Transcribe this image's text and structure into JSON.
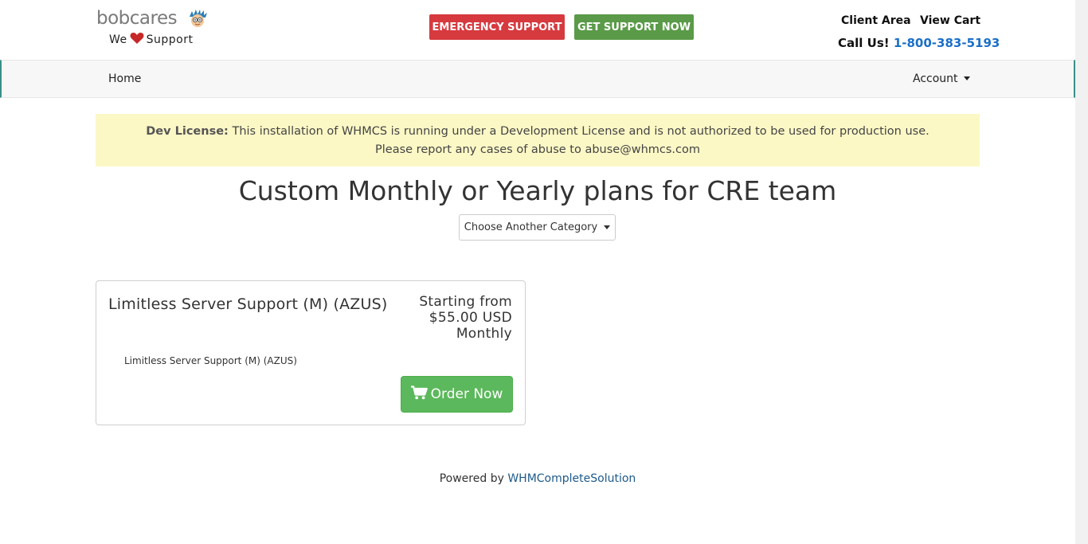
{
  "header": {
    "logo_word": "bobcares",
    "logo_tag_before": "We",
    "logo_tag_after": "Support",
    "emergency_label": "EMERGENCY SUPPORT",
    "get_support_label": "GET SUPPORT NOW",
    "client_area_label": "Client Area",
    "view_cart_label": "View Cart",
    "call_label": "Call Us!",
    "phone": "1-800-383-5193"
  },
  "nav": {
    "home_label": "Home",
    "account_label": "Account"
  },
  "notice": {
    "label": "Dev License:",
    "text": "This installation of WHMCS is running under a Development License and is not authorized to be used for production use. Please report any cases of abuse to abuse@whmcs.com"
  },
  "main": {
    "title": "Custom Monthly or Yearly plans for CRE team",
    "category_select_label": "Choose Another Category"
  },
  "product": {
    "name": "Limitless Server Support (M) (AZUS)",
    "price_line1": "Starting from",
    "price_line2": "$55.00 USD",
    "price_line3": "Monthly",
    "description": "Limitless Server Support (M) (AZUS)",
    "order_label": "Order Now"
  },
  "footer": {
    "powered_by": "Powered by",
    "link_label": "WHMCompleteSolution"
  },
  "colors": {
    "emergency": "#d63a3f",
    "get_support": "#5a9a48",
    "phone": "#1b6fc7",
    "notice_bg": "#fcf8c6",
    "order_button": "#5cb85c",
    "footer_link": "#1d5a8a"
  },
  "icons": {
    "logo_mascot": "mascot-face-icon",
    "heart": "heart-icon",
    "cart": "shopping-cart-icon",
    "dropdown": "caret-down-icon"
  }
}
